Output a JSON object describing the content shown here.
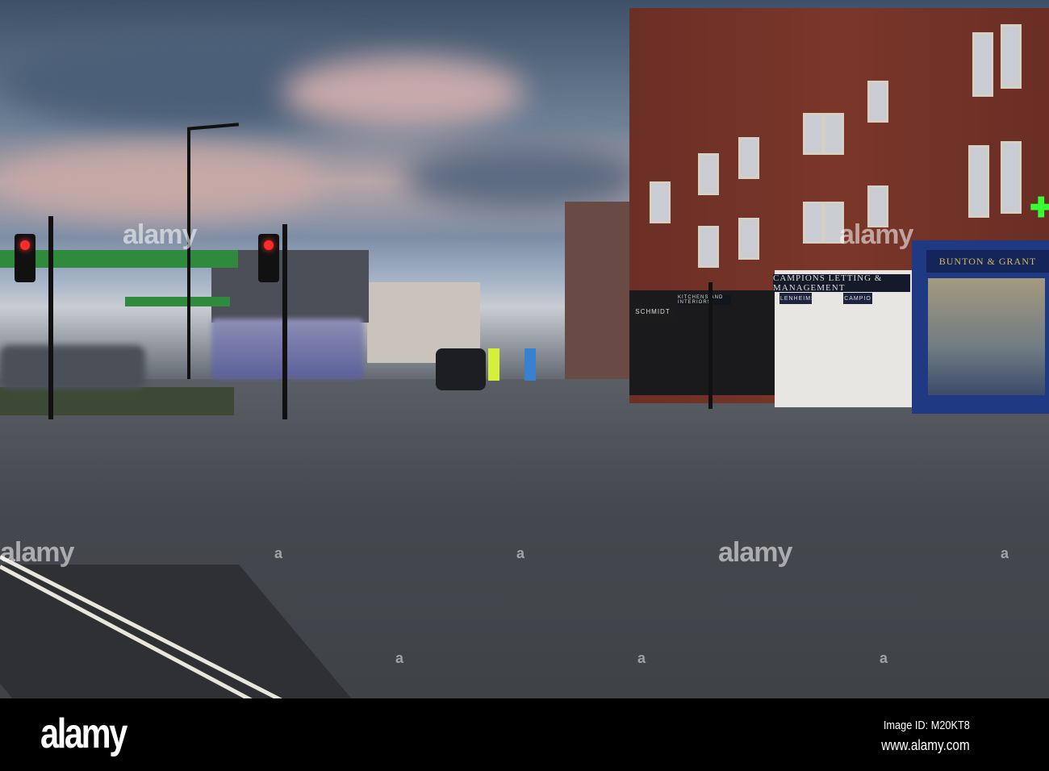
{
  "photo": {
    "watermark": "alamy",
    "shop_signs": {
      "bunton": "BUNTON & GRANT",
      "campions": "CAMPIONS  LETTING & MANAGEMENT",
      "blenheims": "BLENHEIMS",
      "campions_small": "CAMPIO",
      "schmidt": "SCHMIDT",
      "kitchens": "KITCHENS AND INTERIORS"
    }
  },
  "footer": {
    "logo": "alamy",
    "image_id": "Image ID: M20KT8",
    "url": "www.alamy.com"
  }
}
